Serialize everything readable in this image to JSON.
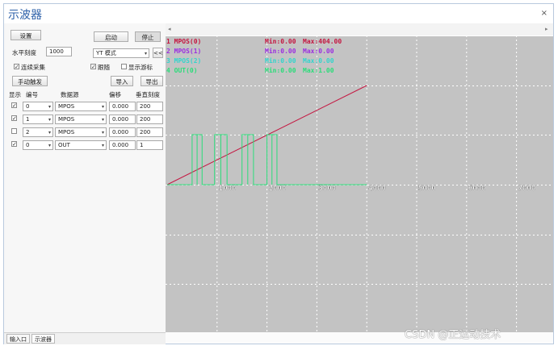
{
  "window": {
    "title": "示波器",
    "close_label": "×"
  },
  "toolbar": {
    "settings_label": "设置",
    "start_label": "启动",
    "stop_label": "停止"
  },
  "horizontal": {
    "label": "水平刻度",
    "value": "1000",
    "mode": "YT 模式",
    "collapse_label": "<<"
  },
  "options": {
    "continuous_label": "连续采集",
    "continuous_checked": true,
    "follow_label": "跟随",
    "follow_checked": true,
    "cursor_label": "显示游标",
    "cursor_checked": false
  },
  "actions": {
    "manual_trigger_label": "手动触发",
    "import_label": "导入",
    "export_label": "导出"
  },
  "table": {
    "headers": [
      "显示",
      "编号",
      "数据源",
      "偏移",
      "垂直刻度"
    ],
    "rows": [
      {
        "show": true,
        "index": "0",
        "source": "MPOS",
        "offset": "0.000",
        "scale": "200"
      },
      {
        "show": true,
        "index": "1",
        "source": "MPOS",
        "offset": "0.000",
        "scale": "200"
      },
      {
        "show": false,
        "index": "2",
        "source": "MPOS",
        "offset": "0.000",
        "scale": "200"
      },
      {
        "show": true,
        "index": "0",
        "source": "OUT",
        "offset": "0.000",
        "scale": "1"
      }
    ]
  },
  "tabs": [
    {
      "label": "输入口",
      "active": false
    },
    {
      "label": "示波器",
      "active": true
    }
  ],
  "scope": {
    "channels": [
      {
        "label": "1 MPOS(0)",
        "min": "Min:0.00",
        "max": "Max:404.00",
        "color": "#c41640"
      },
      {
        "label": "2 MPOS(1)",
        "min": "Min:0.00",
        "max": "Max:0.00",
        "color": "#9b2fe0"
      },
      {
        "label": "3 MPOS(2)",
        "min": "Min:0.00",
        "max": "Max:0.00",
        "color": "#33d4cc"
      },
      {
        "label": "4 OUT(0)",
        "min": "Min:0.00",
        "max": "Max:1.00",
        "color": "#2bdc7a"
      }
    ],
    "x_ticks": [
      "1000",
      "2000",
      "3000",
      "4000",
      "5000",
      "6000",
      "7000"
    ],
    "background": "#c3c3c3",
    "grid_color": "#ffffff"
  },
  "chart_data": {
    "type": "line",
    "xlim": [
      0,
      7600
    ],
    "x_ticks": [
      1000,
      2000,
      3000,
      4000,
      5000,
      6000,
      7000
    ],
    "grid": true,
    "series": [
      {
        "name": "1 MPOS(0)",
        "color": "#c41640",
        "x": [
          0,
          4000
        ],
        "y": [
          0,
          404
        ]
      },
      {
        "name": "4 OUT(0)",
        "color": "#2bdc7a",
        "steps": [
          [
            500,
            700
          ],
          [
            950,
            1200
          ],
          [
            1500,
            1730
          ],
          [
            2000,
            2200
          ]
        ]
      }
    ]
  },
  "watermark": "CSDN @正运动技术"
}
